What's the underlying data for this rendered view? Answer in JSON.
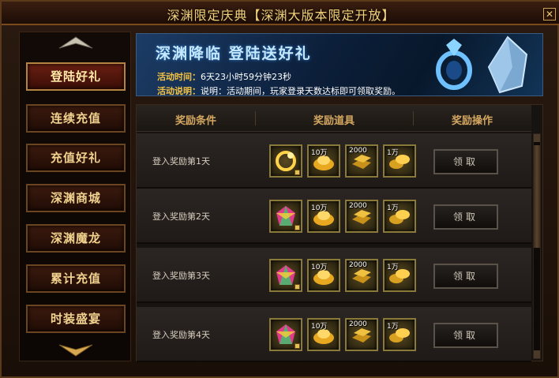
{
  "window": {
    "title": "深渊限定庆典【深渊大版本限定开放】",
    "close_label": "✕"
  },
  "nav": {
    "items": [
      {
        "label": "登陆好礼",
        "active": true
      },
      {
        "label": "连续充值"
      },
      {
        "label": "充值好礼"
      },
      {
        "label": "深渊商城"
      },
      {
        "label": "深渊魔龙"
      },
      {
        "label": "累计充值"
      },
      {
        "label": "时装盛宴"
      }
    ]
  },
  "banner": {
    "title": "深渊降临 登陆送好礼",
    "time_label": "活动时间：",
    "time_value": "6天23小时59分钟23秒",
    "desc_label": "活动说明：",
    "desc_value": "说明：活动期间，玩家登录天数达标即可领取奖励。"
  },
  "table": {
    "headers": [
      "奖励条件",
      "奖励道具",
      "奖励操作"
    ],
    "rows": [
      {
        "condition": "登入奖励第1天",
        "items": [
          "",
          "10万",
          "2000",
          "1万"
        ],
        "claim": "领取"
      },
      {
        "condition": "登入奖励第2天",
        "items": [
          "",
          "10万",
          "2000",
          "1万"
        ],
        "claim": "领取"
      },
      {
        "condition": "登入奖励第3天",
        "items": [
          "",
          "10万",
          "2000",
          "1万"
        ],
        "claim": "领取"
      },
      {
        "condition": "登入奖励第4天",
        "items": [
          "",
          "10万",
          "2000",
          "1万"
        ],
        "claim": "领取"
      }
    ]
  },
  "icons": {
    "slot1_day1": "gold-ring-icon",
    "slot1_other": "rainbow-gem-icon",
    "slot2": "gold-ingot-icon",
    "slot3": "gold-bars-icon",
    "slot4": "gold-coins-icon"
  },
  "colors": {
    "accent": "#f3d27a",
    "label": "#f6c240",
    "active_nav": "#6a1f12"
  }
}
